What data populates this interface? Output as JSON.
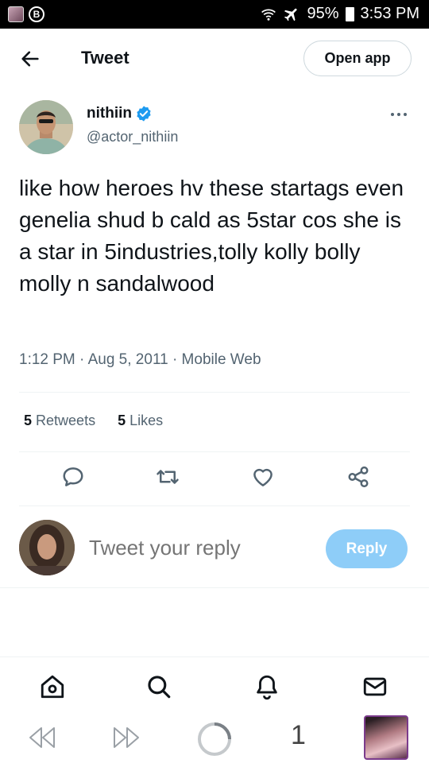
{
  "status_bar": {
    "battery": "95%",
    "time": "3:53 PM",
    "badge": "B"
  },
  "header": {
    "title": "Tweet",
    "open_app_label": "Open app"
  },
  "tweet": {
    "author_name": "nithiin",
    "author_handle": "@actor_nithiin",
    "text": "like how heroes hv these startags even genelia shud b cald as 5star cos she is a star in 5industries,tolly kolly bolly molly n sandalwood",
    "meta": "1:12 PM · Aug 5, 2011 · Mobile Web",
    "retweets_count": "5",
    "retweets_label": "Retweets",
    "likes_count": "5",
    "likes_label": "Likes"
  },
  "reply": {
    "placeholder": "Tweet your reply",
    "button_label": "Reply"
  },
  "browser": {
    "tab_count": "1"
  },
  "colors": {
    "accent": "#1d9bf0",
    "reply_button_disabled": "#8ecdf8",
    "secondary_text": "#536471"
  },
  "icons": {
    "back": "arrow-left-icon",
    "verified": "verified-badge-icon",
    "more": "more-horizontal-icon",
    "reply": "comment-icon",
    "retweet": "retweet-icon",
    "like": "heart-icon",
    "share": "share-icon",
    "home": "home-icon",
    "search": "search-icon",
    "notifications": "bell-icon",
    "messages": "mail-icon"
  }
}
